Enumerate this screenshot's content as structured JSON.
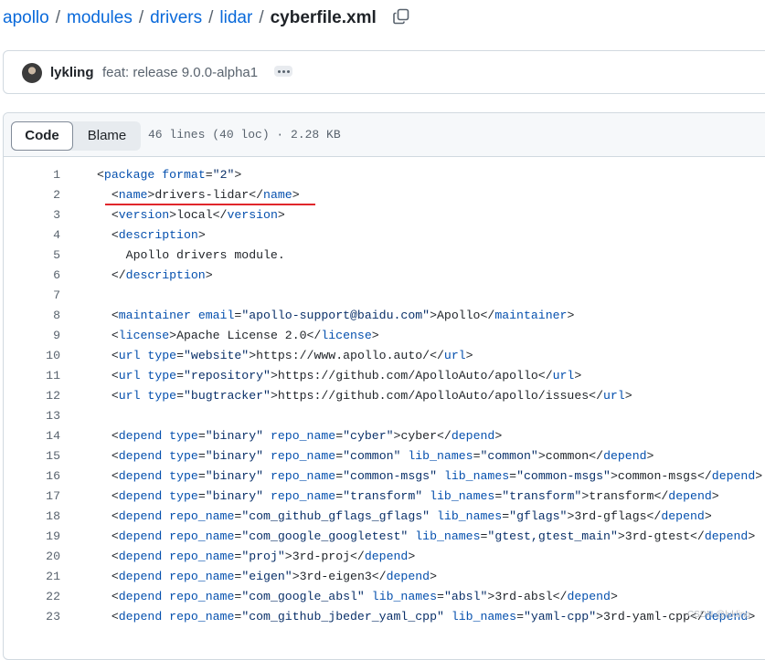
{
  "breadcrumb": {
    "parts": [
      "apollo",
      "modules",
      "drivers",
      "lidar"
    ],
    "separator": "/",
    "file": "cyberfile.xml"
  },
  "commit": {
    "author": "lykling",
    "message": "feat: release 9.0.0-alpha1"
  },
  "file_header": {
    "tabs": [
      "Code",
      "Blame"
    ],
    "active_tab": "Code",
    "info": "46 lines (40 loc) · 2.28 KB"
  },
  "code_lines": [
    {
      "n": "1",
      "text": "<package format=\"2\">"
    },
    {
      "n": "2",
      "text": "  <name>drivers-lidar</name>"
    },
    {
      "n": "3",
      "text": "  <version>local</version>"
    },
    {
      "n": "4",
      "text": "  <description>"
    },
    {
      "n": "5",
      "text": "    Apollo drivers module."
    },
    {
      "n": "6",
      "text": "  </description>"
    },
    {
      "n": "7",
      "text": ""
    },
    {
      "n": "8",
      "text": "  <maintainer email=\"apollo-support@baidu.com\">Apollo</maintainer>"
    },
    {
      "n": "9",
      "text": "  <license>Apache License 2.0</license>"
    },
    {
      "n": "10",
      "text": "  <url type=\"website\">https://www.apollo.auto/</url>"
    },
    {
      "n": "11",
      "text": "  <url type=\"repository\">https://github.com/ApolloAuto/apollo</url>"
    },
    {
      "n": "12",
      "text": "  <url type=\"bugtracker\">https://github.com/ApolloAuto/apollo/issues</url>"
    },
    {
      "n": "13",
      "text": ""
    },
    {
      "n": "14",
      "text": "  <depend type=\"binary\" repo_name=\"cyber\">cyber</depend>"
    },
    {
      "n": "15",
      "text": "  <depend type=\"binary\" repo_name=\"common\" lib_names=\"common\">common</depend>"
    },
    {
      "n": "16",
      "text": "  <depend type=\"binary\" repo_name=\"common-msgs\" lib_names=\"common-msgs\">common-msgs</depend>"
    },
    {
      "n": "17",
      "text": "  <depend type=\"binary\" repo_name=\"transform\" lib_names=\"transform\">transform</depend>"
    },
    {
      "n": "18",
      "text": "  <depend repo_name=\"com_github_gflags_gflags\" lib_names=\"gflags\">3rd-gflags</depend>"
    },
    {
      "n": "19",
      "text": "  <depend repo_name=\"com_google_googletest\" lib_names=\"gtest,gtest_main\">3rd-gtest</depend>"
    },
    {
      "n": "20",
      "text": "  <depend repo_name=\"proj\">3rd-proj</depend>"
    },
    {
      "n": "21",
      "text": "  <depend repo_name=\"eigen\">3rd-eigen3</depend>"
    },
    {
      "n": "22",
      "text": "  <depend repo_name=\"com_google_absl\" lib_names=\"absl\">3rd-absl</depend>"
    },
    {
      "n": "23",
      "text": "  <depend repo_name=\"com_github_jbeder_yaml_cpp\" lib_names=\"yaml-cpp\">3rd-yaml-cpp</depend>"
    }
  ],
  "watermark": "CSDN @lykling",
  "colors": {
    "link": "#0969da",
    "tag": "#0550ae",
    "string": "#0a3069",
    "annotation": "#e0262b"
  }
}
